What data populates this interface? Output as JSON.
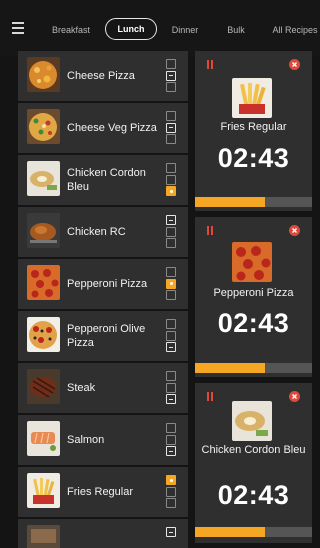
{
  "nav": {
    "tabs": [
      {
        "label": "Breakfast"
      },
      {
        "label": "Lunch"
      },
      {
        "label": "Dinner"
      },
      {
        "label": "Bulk"
      },
      {
        "label": "All Recipes"
      }
    ],
    "active_tab": "Lunch"
  },
  "items": [
    {
      "name": "Cheese Pizza",
      "checks": [
        "empty",
        "selected",
        "empty"
      ]
    },
    {
      "name": "Cheese Veg Pizza",
      "checks": [
        "empty",
        "selected",
        "empty"
      ]
    },
    {
      "name": "Chicken Cordon Bleu",
      "checks": [
        "empty",
        "empty",
        "orange"
      ]
    },
    {
      "name": "Chicken RC",
      "checks": [
        "selected",
        "empty",
        "empty"
      ]
    },
    {
      "name": "Pepperoni Pizza",
      "checks": [
        "empty",
        "orange",
        "empty"
      ]
    },
    {
      "name": "Pepperoni Olive Pizza",
      "checks": [
        "empty",
        "empty",
        "selected"
      ]
    },
    {
      "name": "Steak",
      "checks": [
        "empty",
        "empty",
        "selected"
      ]
    },
    {
      "name": "Salmon",
      "checks": [
        "empty",
        "empty",
        "selected"
      ]
    },
    {
      "name": "Fries Regular",
      "checks": [
        "orange",
        "empty",
        "empty"
      ]
    },
    {
      "name": "",
      "checks": [
        "selected"
      ]
    }
  ],
  "timers": [
    {
      "name": "Fries Regular",
      "time": "02:43",
      "progress": 0.6
    },
    {
      "name": "Pepperoni Pizza",
      "time": "02:43",
      "progress": 0.6
    },
    {
      "name": "Chicken Cordon Bleu",
      "time": "02:43",
      "progress": 0.6
    }
  ],
  "colors": {
    "accent": "#f5a623",
    "danger": "#e0483a",
    "panel": "#2f2f2f",
    "background": "#141414"
  },
  "icons": {
    "menu": "hamburger-menu-icon",
    "pause": "pause-icon",
    "close": "close-icon"
  }
}
